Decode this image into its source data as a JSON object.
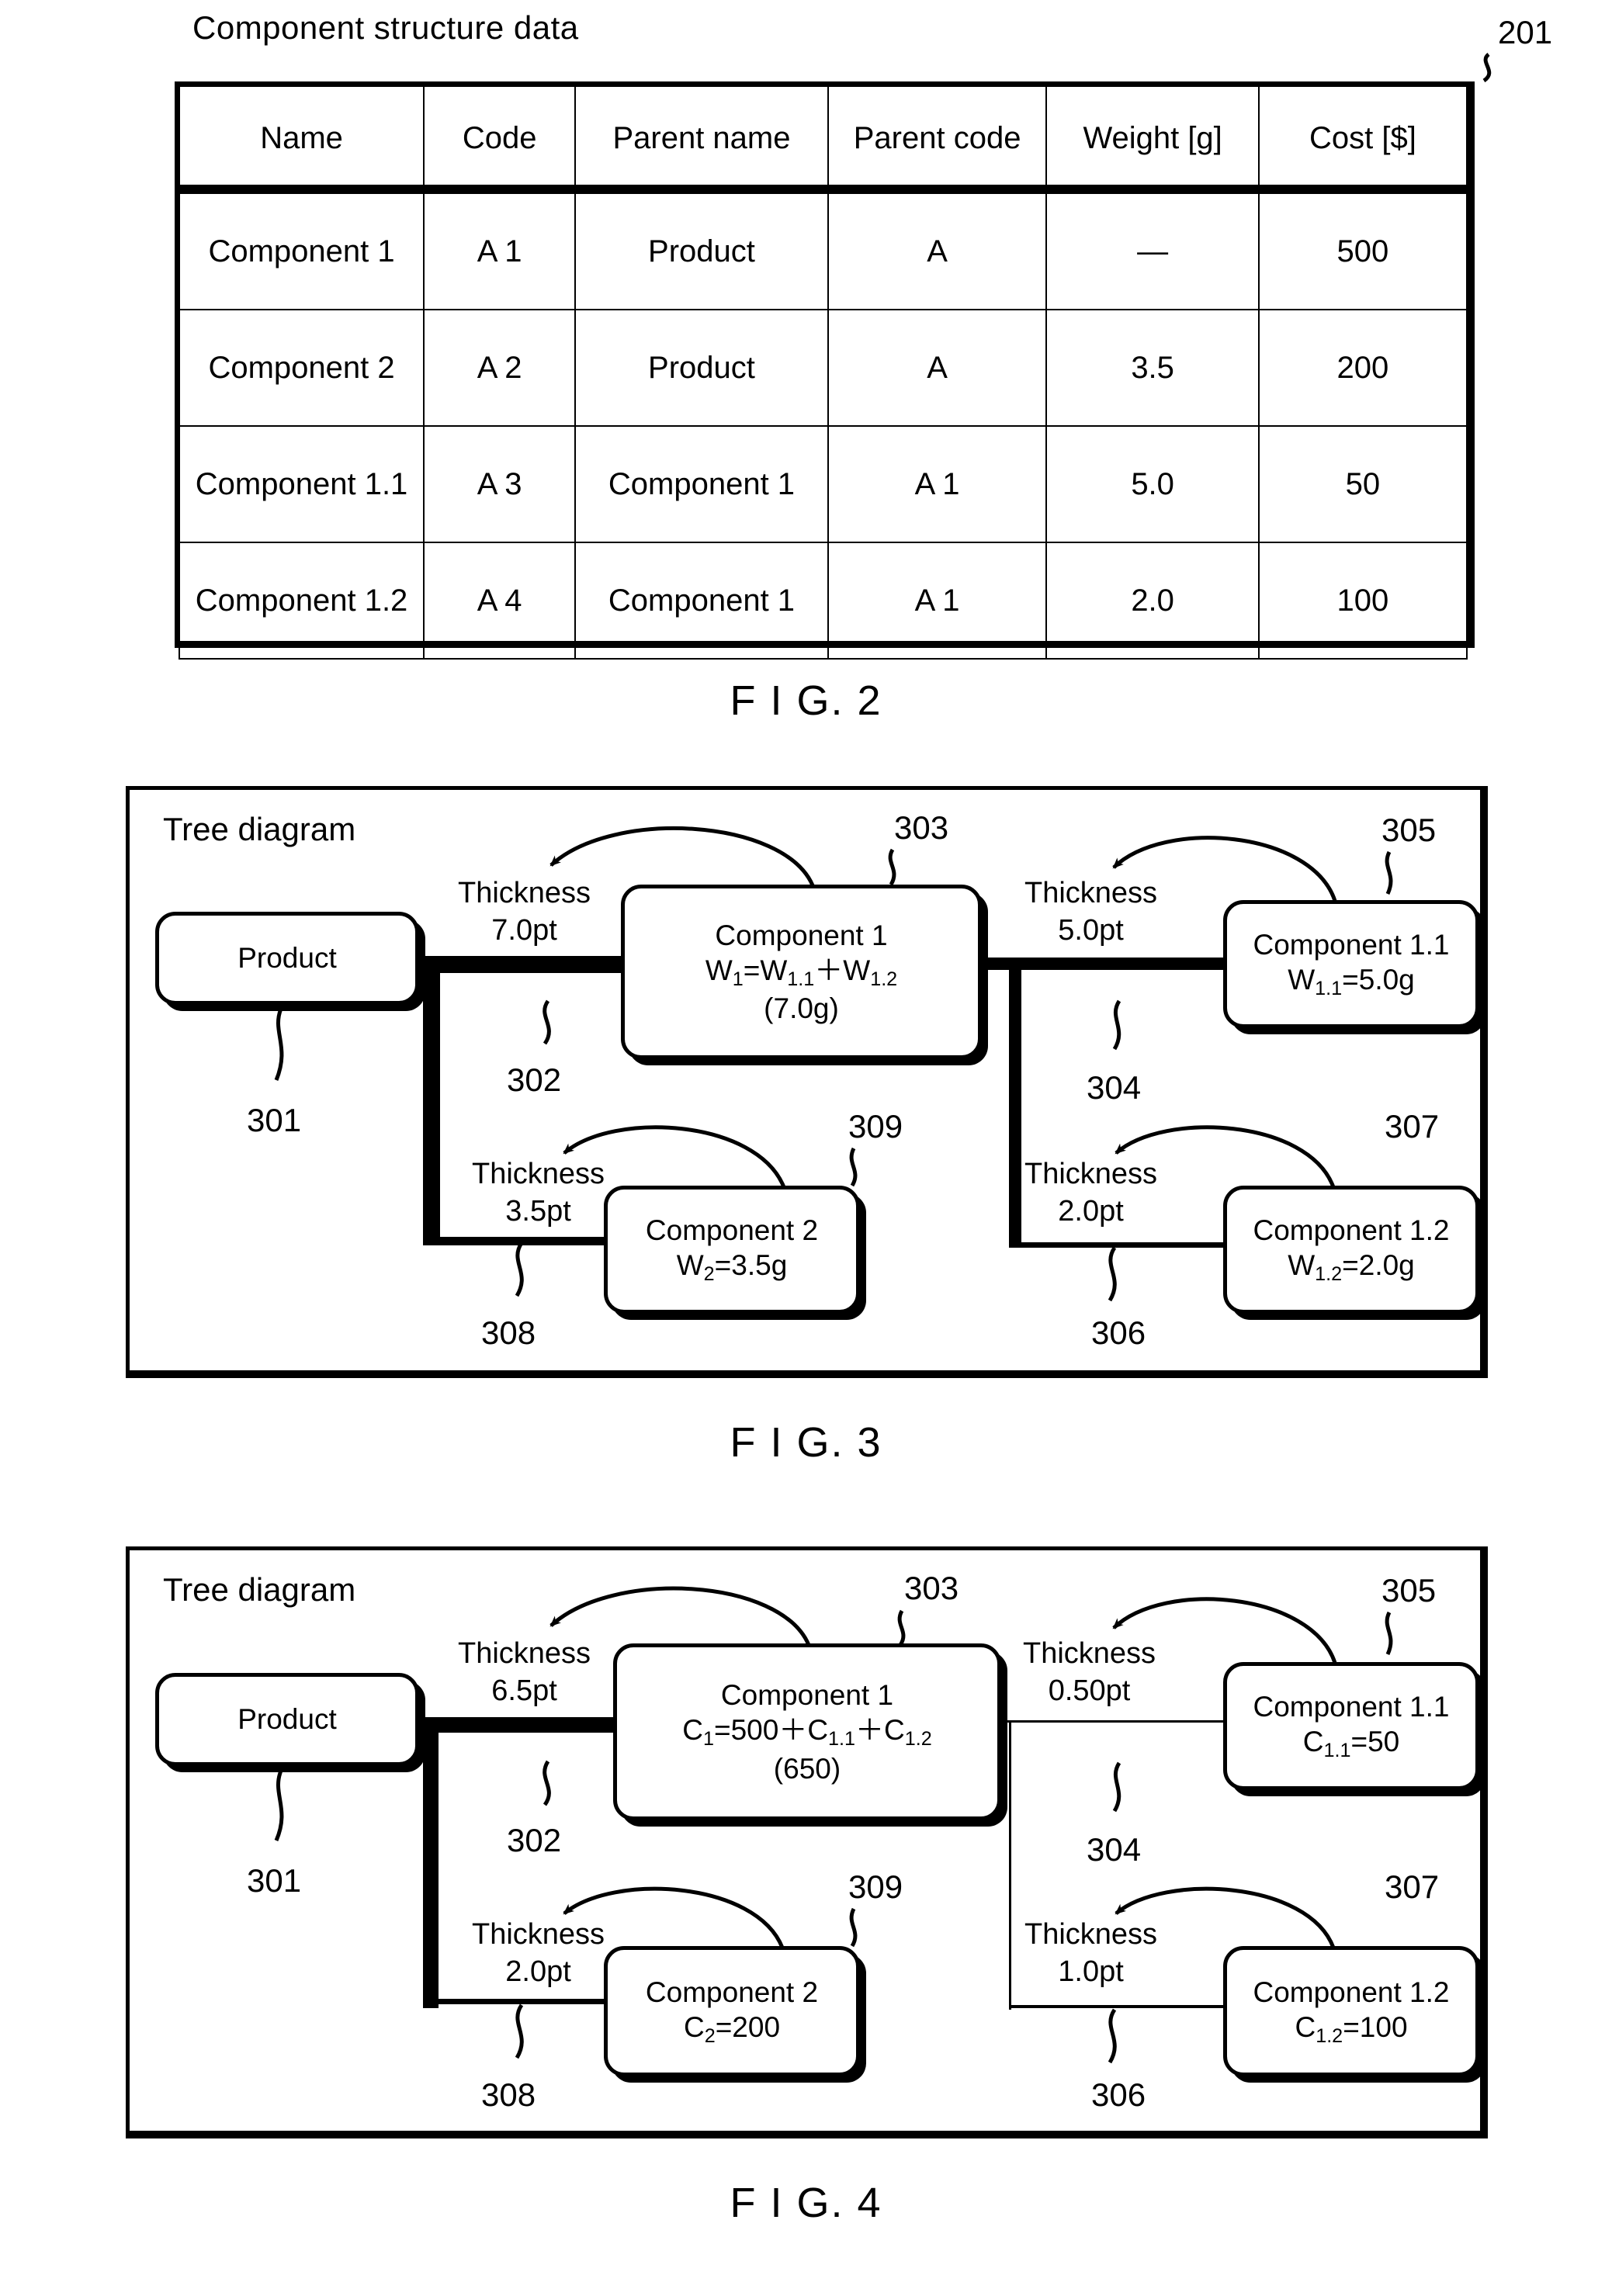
{
  "figures": [
    {
      "id": "fig2",
      "caption": "F I G. 2",
      "title": "Component structure data",
      "ref": "201",
      "table": {
        "headers": [
          "Name",
          "Code",
          "Parent name",
          "Parent code",
          "Weight [g]",
          "Cost [$]"
        ],
        "rows": [
          [
            "Component 1",
            "A 1",
            "Product",
            "A",
            "—",
            "500"
          ],
          [
            "Component 2",
            "A 2",
            "Product",
            "A",
            "3.5",
            "200"
          ],
          [
            "Component 1.1",
            "A 3",
            "Component 1",
            "A 1",
            "5.0",
            "50"
          ],
          [
            "Component 1.2",
            "A 4",
            "Component 1",
            "A 1",
            "2.0",
            "100"
          ]
        ]
      }
    },
    {
      "id": "fig3",
      "caption": "F I G. 3",
      "panel_title": "Tree diagram",
      "nodes": {
        "product": {
          "ref": "301",
          "line1": "Product",
          "line2": "",
          "line3": ""
        },
        "comp1": {
          "ref": "303",
          "line1": "Component 1",
          "line2": "W1=W1.1+W1.2",
          "line3": "(7.0g)",
          "l2_html": "W<sub>1</sub>=W<sub>1.1</sub>＋W<sub>1.2</sub>"
        },
        "comp11": {
          "ref": "305",
          "line1": "Component 1.1",
          "line2": "W1.1=5.0g",
          "line3": "",
          "l2_html": "W<sub>1.1</sub>=5.0g"
        },
        "comp12": {
          "ref": "307",
          "line1": "Component 1.2",
          "line2": "W1.2=2.0g",
          "line3": "",
          "l2_html": "W<sub>1.2</sub>=2.0g"
        },
        "comp2": {
          "ref": "309",
          "line1": "Component 2",
          "line2": "W2=3.5g",
          "line3": "",
          "l2_html": "W<sub>2</sub>=3.5g"
        }
      },
      "connectors": [
        {
          "ref": "302",
          "label_line1": "Thickness",
          "label_line2": "7.0pt",
          "points_pt": 7.0
        },
        {
          "ref": "304",
          "label_line1": "Thickness",
          "label_line2": "5.0pt",
          "points_pt": 5.0
        },
        {
          "ref": "306",
          "label_line1": "Thickness",
          "label_line2": "2.0pt",
          "points_pt": 2.0
        },
        {
          "ref": "308",
          "label_line1": "Thickness",
          "label_line2": "3.5pt",
          "points_pt": 3.5
        }
      ]
    },
    {
      "id": "fig4",
      "caption": "F I G. 4",
      "panel_title": "Tree diagram",
      "nodes": {
        "product": {
          "ref": "301",
          "line1": "Product",
          "line2": "",
          "line3": ""
        },
        "comp1": {
          "ref": "303",
          "line1": "Component 1",
          "line2": "C1=500+C1.1+C1.2",
          "line3": "(650)",
          "l2_html": "C<sub>1</sub>=500＋C<sub>1.1</sub>＋C<sub>1.2</sub>"
        },
        "comp11": {
          "ref": "305",
          "line1": "Component 1.1",
          "line2": "C1.1=50",
          "line3": "",
          "l2_html": "C<sub>1.1</sub>=50"
        },
        "comp12": {
          "ref": "307",
          "line1": "Component 1.2",
          "line2": "C1.2=100",
          "line3": "",
          "l2_html": "C<sub>1.2</sub>=100"
        },
        "comp2": {
          "ref": "309",
          "line1": "Component 2",
          "line2": "C2=200",
          "line3": "",
          "l2_html": "C<sub>2</sub>=200"
        }
      },
      "connectors": [
        {
          "ref": "302",
          "label_line1": "Thickness",
          "label_line2": "6.5pt",
          "points_pt": 6.5
        },
        {
          "ref": "304",
          "label_line1": "Thickness",
          "label_line2": "0.50pt",
          "points_pt": 0.5
        },
        {
          "ref": "306",
          "label_line1": "Thickness",
          "label_line2": "1.0pt",
          "points_pt": 1.0
        },
        {
          "ref": "308",
          "label_line1": "Thickness",
          "label_line2": "2.0pt",
          "points_pt": 2.0
        }
      ]
    }
  ],
  "chart_data": {
    "type": "diagram",
    "title": "Component structure data / Tree diagram",
    "description": "Patent figures: component structure table (FIG.2) and two tree diagrams where connector line thickness encodes weight (FIG.3) and cost (FIG.4).",
    "table": {
      "columns": [
        "Name",
        "Code",
        "Parent name",
        "Parent code",
        "Weight [g]",
        "Cost [$]"
      ],
      "rows": [
        {
          "Name": "Component 1",
          "Code": "A 1",
          "Parent name": "Product",
          "Parent code": "A",
          "Weight [g]": "—",
          "Cost [$]": "500"
        },
        {
          "Name": "Component 2",
          "Code": "A 2",
          "Parent name": "Product",
          "Parent code": "A",
          "Weight [g]": "3.5",
          "Cost [$]": "200"
        },
        {
          "Name": "Component 1.1",
          "Code": "A 3",
          "Parent name": "Component 1",
          "Parent code": "A 1",
          "Weight [g]": "5.0",
          "Cost [$]": "50"
        },
        {
          "Name": "Component 1.2",
          "Code": "A 4",
          "Parent name": "Component 1",
          "Parent code": "A 1",
          "Weight [g]": "2.0",
          "Cost [$]": "100"
        }
      ]
    },
    "tree_weight": {
      "edges": [
        {
          "from": "Product",
          "to": "Component 1",
          "thickness_pt": 7.0,
          "ref": "302"
        },
        {
          "from": "Product",
          "to": "Component 2",
          "thickness_pt": 3.5,
          "ref": "308"
        },
        {
          "from": "Component 1",
          "to": "Component 1.1",
          "thickness_pt": 5.0,
          "ref": "304"
        },
        {
          "from": "Component 1",
          "to": "Component 1.2",
          "thickness_pt": 2.0,
          "ref": "306"
        }
      ],
      "node_values": {
        "Component 1": "7.0g",
        "Component 1.1": "5.0g",
        "Component 1.2": "2.0g",
        "Component 2": "3.5g"
      }
    },
    "tree_cost": {
      "edges": [
        {
          "from": "Product",
          "to": "Component 1",
          "thickness_pt": 6.5,
          "ref": "302"
        },
        {
          "from": "Product",
          "to": "Component 2",
          "thickness_pt": 2.0,
          "ref": "308"
        },
        {
          "from": "Component 1",
          "to": "Component 1.1",
          "thickness_pt": 0.5,
          "ref": "304"
        },
        {
          "from": "Component 1",
          "to": "Component 1.2",
          "thickness_pt": 1.0,
          "ref": "306"
        }
      ],
      "node_values": {
        "Component 1": "650",
        "Component 1.1": "50",
        "Component 1.2": "100",
        "Component 2": "200"
      }
    }
  }
}
